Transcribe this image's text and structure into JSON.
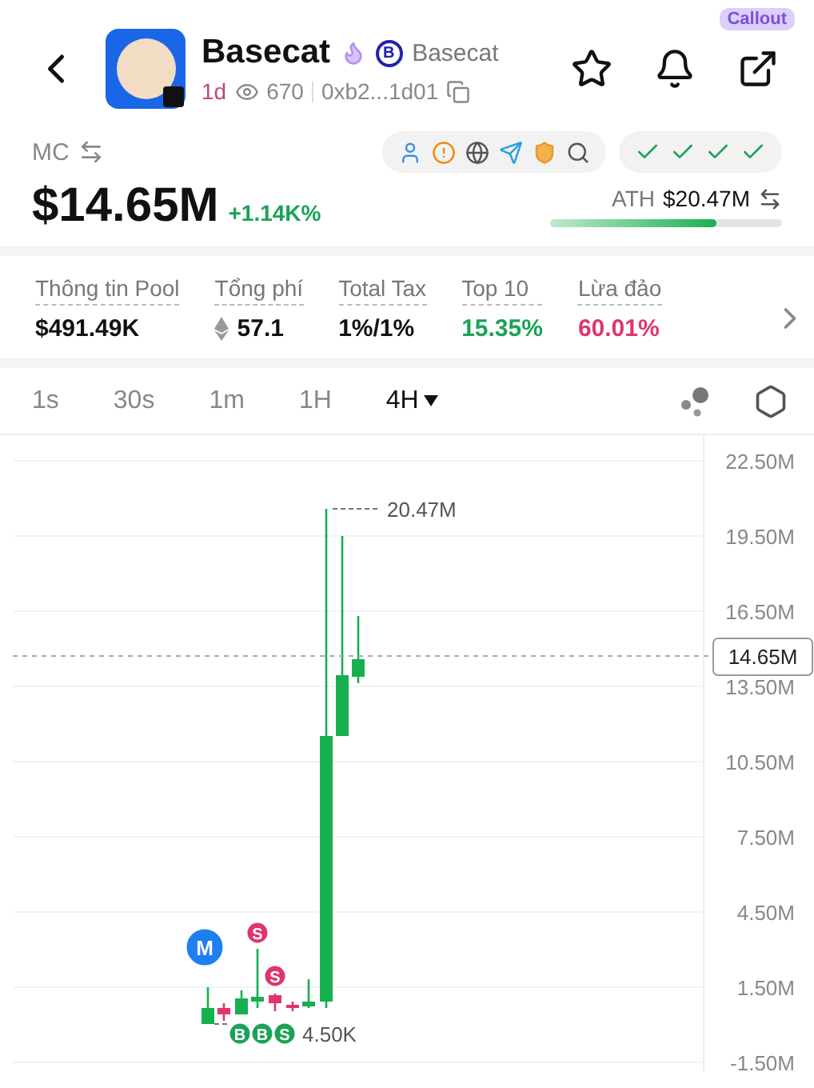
{
  "header": {
    "name": "Basecat",
    "chain_badge": "B",
    "symbol": "Basecat",
    "age": "1d",
    "views": "670",
    "address": "0xb2...1d01",
    "callout": "Callout",
    "hot": true,
    "starred": false
  },
  "market": {
    "label": "MC",
    "value": "$14.65M",
    "change": "+1.14K%",
    "ath_label": "ATH",
    "ath_value": "$20.47M",
    "ath_bar": {
      "level": 0.72
    },
    "checks": [
      {
        "passed": true
      },
      {
        "passed": true
      },
      {
        "passed": true
      },
      {
        "passed": true
      }
    ]
  },
  "stats": [
    {
      "label": "Thông tin Pool",
      "value": "$491.49K"
    },
    {
      "label": "Tổng phí",
      "value": "57.1",
      "kind": "eth"
    },
    {
      "label": "Total Tax",
      "value": "1%/1%"
    },
    {
      "label": "Top 10",
      "value": "15.35%",
      "color": "#1ba256"
    },
    {
      "label": "Lừa đảo",
      "value": "60.01%",
      "color": "#e0356a"
    }
  ],
  "timeframes": [
    {
      "label": "1s",
      "selected": false
    },
    {
      "label": "30s",
      "selected": false
    },
    {
      "label": "1m",
      "selected": false
    },
    {
      "label": "1H",
      "selected": false
    },
    {
      "label": "4H",
      "selected": true
    }
  ],
  "chart": {
    "y_ticks": [
      "22.50M",
      "19.50M",
      "16.50M",
      "13.50M",
      "10.50M",
      "7.50M",
      "4.50M",
      "1.50M",
      "-1.50M"
    ],
    "price_tag": "14.65M",
    "high_label": "20.47M",
    "low_label": "4.50K",
    "markers": [
      {
        "label": "M",
        "kind": "mint"
      },
      {
        "label": "S",
        "kind": "sell"
      },
      {
        "label": "S",
        "kind": "sell"
      },
      {
        "label": "B",
        "kind": "buy"
      },
      {
        "label": "B",
        "kind": "buy"
      },
      {
        "label": "S",
        "kind": "buy"
      }
    ]
  }
}
